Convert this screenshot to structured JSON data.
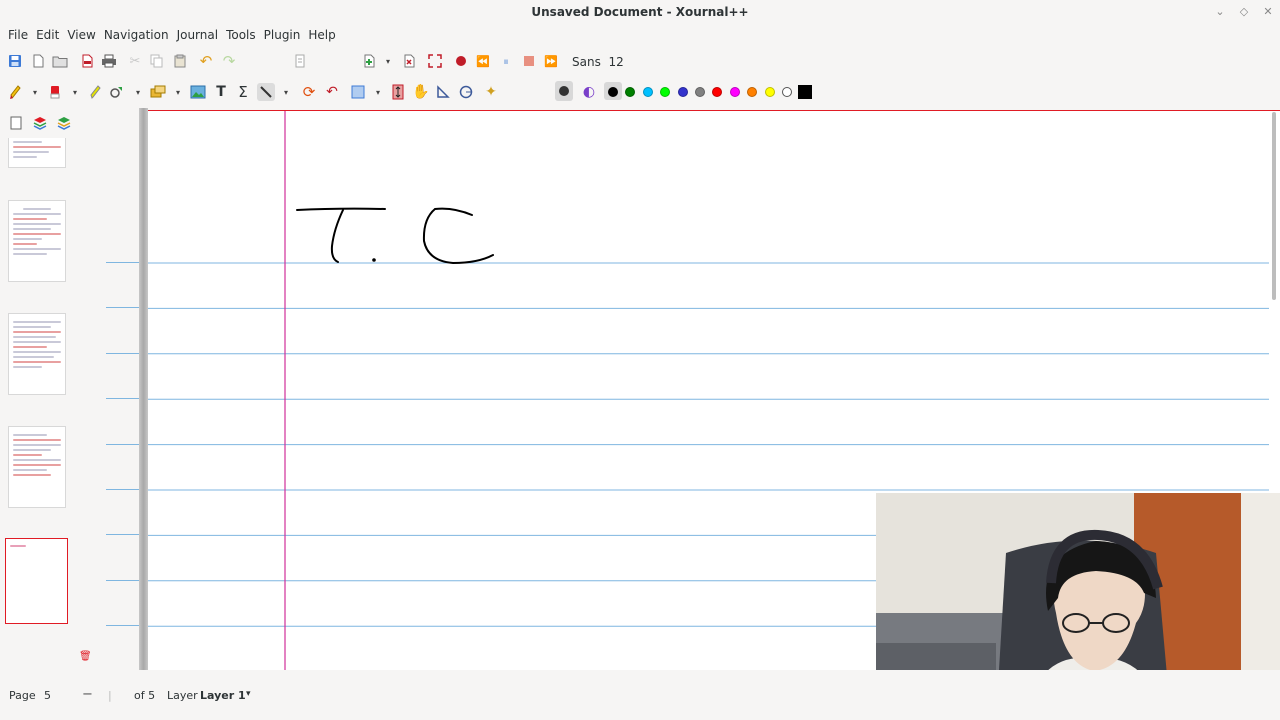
{
  "window": {
    "title": "Unsaved Document - Xournal++"
  },
  "menu": [
    "File",
    "Edit",
    "View",
    "Navigation",
    "Journal",
    "Tools",
    "Plugin",
    "Help"
  ],
  "toolbar": {
    "font_name": "Sans",
    "font_size": "12",
    "palette": [
      "#000000",
      "#008000",
      "#00c0ff",
      "#00ff00",
      "#3333cc",
      "#808080",
      "#ff0000",
      "#ff00ff",
      "#ff8000",
      "#ffff00",
      "#ffffff"
    ],
    "selected_color": "#000000"
  },
  "status": {
    "page_label": "Page",
    "page_value": "5",
    "of_pages": "of 5",
    "layer_label": "Layer",
    "layer_value": "Layer 1"
  },
  "document": {
    "handwriting": "T. C"
  },
  "colors": {
    "rule_line": "#7fb6e0",
    "margin_line": "#d0309a",
    "page_border": "#e01b24"
  }
}
